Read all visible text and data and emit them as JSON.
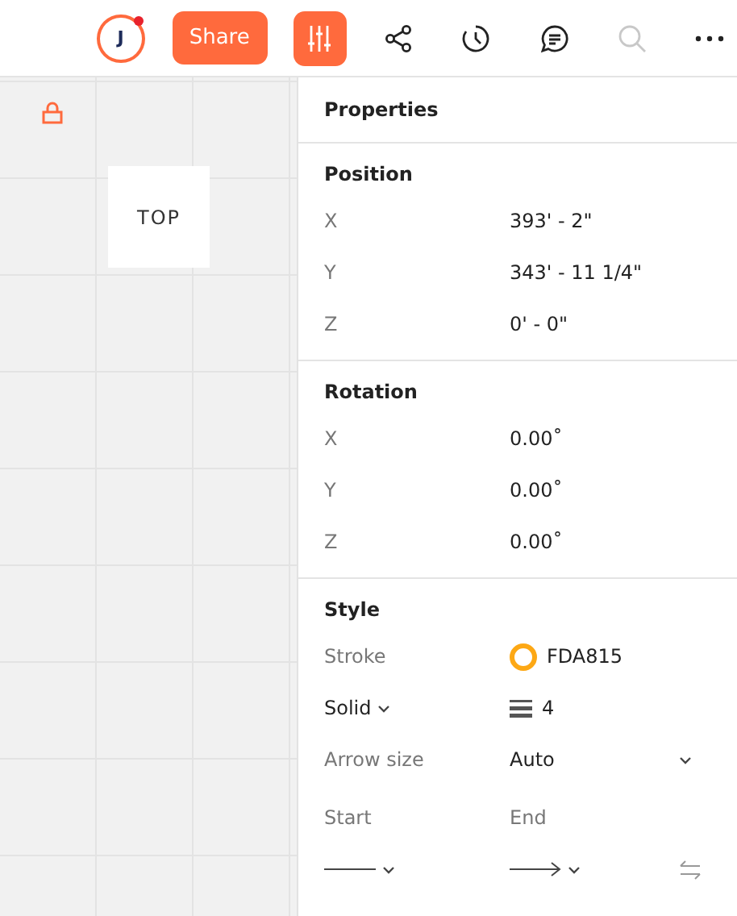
{
  "toolbar": {
    "avatar": {
      "initial": "J",
      "notification": true
    },
    "share": "Share",
    "tools": [
      {
        "kind": "adjust",
        "selected": true,
        "disabled": false
      },
      {
        "kind": "share",
        "selected": false,
        "disabled": false
      },
      {
        "kind": "history",
        "selected": false,
        "disabled": false
      },
      {
        "kind": "comment",
        "selected": false,
        "disabled": false
      },
      {
        "kind": "search",
        "selected": false,
        "disabled": true
      },
      {
        "kind": "more",
        "selected": false,
        "disabled": false
      }
    ]
  },
  "canvas": {
    "locked": true,
    "card": "TOP"
  },
  "properties": {
    "title": "Properties",
    "sections": [
      {
        "title": "Position",
        "rows": [
          {
            "label": "X",
            "value": "393' - 2\""
          },
          {
            "label": "Y",
            "value": "343' - 11 1/4\""
          },
          {
            "label": "Z",
            "value": "0' - 0\""
          }
        ]
      },
      {
        "title": "Rotation",
        "rows": [
          {
            "label": "X",
            "value": "0.00˚"
          },
          {
            "label": "Y",
            "value": "0.00˚"
          },
          {
            "label": "Z",
            "value": "0.00˚"
          }
        ]
      }
    ],
    "style": {
      "title": "Style",
      "stroke_label": "Stroke",
      "stroke_value": "FDA815",
      "line_style": "Solid",
      "weight": "4",
      "arrow_size_label": "Arrow size",
      "arrow_size": "Auto",
      "start_label": "Start",
      "end_label": "End"
    }
  }
}
